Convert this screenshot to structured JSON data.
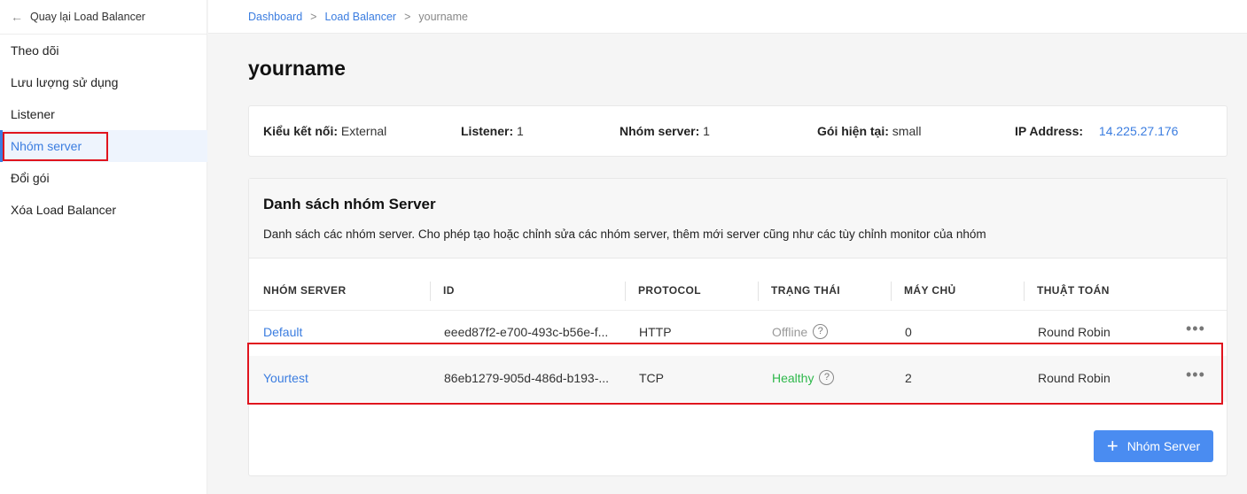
{
  "sidebar": {
    "back_label": "Quay lại Load Balancer",
    "items": [
      {
        "label": "Theo dõi"
      },
      {
        "label": "Lưu lượng sử dụng"
      },
      {
        "label": "Listener"
      },
      {
        "label": "Nhóm server",
        "active": true
      },
      {
        "label": "Đổi gói"
      },
      {
        "label": "Xóa Load Balancer"
      }
    ]
  },
  "breadcrumb": {
    "items": [
      "Dashboard",
      "Load Balancer"
    ],
    "current": "yourname",
    "separator": ">"
  },
  "page_title": "yourname",
  "info": {
    "connection_label": "Kiểu kết nối:",
    "connection_value": "External",
    "listener_label": "Listener:",
    "listener_value": "1",
    "group_label": "Nhóm server:",
    "group_value": "1",
    "plan_label": "Gói hiện tại:",
    "plan_value": "small",
    "ip_label": "IP Address:",
    "ip_value": "14.225.27.176"
  },
  "server_groups": {
    "title": "Danh sách nhóm Server",
    "description": "Danh sách các nhóm server. Cho phép tạo hoặc chỉnh sửa các nhóm server, thêm mới server cũng như các tùy chỉnh monitor của nhóm",
    "columns": [
      "NHÓM SERVER",
      "ID",
      "PROTOCOL",
      "TRẠNG THÁI",
      "MÁY CHỦ",
      "THUẬT TOÁN"
    ],
    "rows": [
      {
        "name": "Default",
        "id": "eeed87f2-e700-493c-b56e-f...",
        "protocol": "HTTP",
        "status": "Offline",
        "servers": "0",
        "algorithm": "Round Robin"
      },
      {
        "name": "Yourtest",
        "id": "86eb1279-905d-486d-b193-...",
        "protocol": "TCP",
        "status": "Healthy",
        "servers": "2",
        "algorithm": "Round Robin"
      }
    ],
    "add_button_label": "Nhóm Server"
  },
  "colors": {
    "accent": "#3b7de0",
    "button": "#4a8cf1",
    "healthy": "#2eb84b",
    "offline": "#999999",
    "highlight": "#e0141e"
  }
}
